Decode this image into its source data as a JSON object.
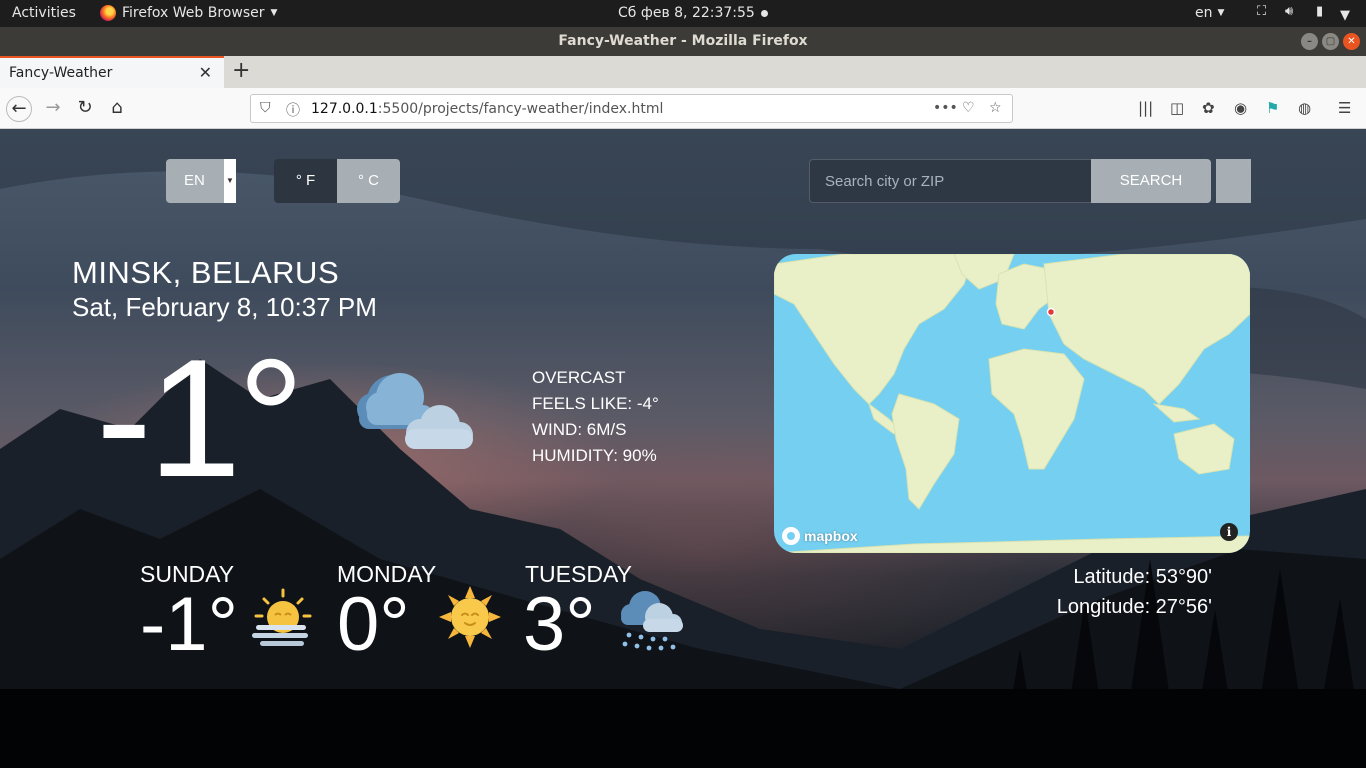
{
  "system_bar": {
    "activities": "Activities",
    "app_menu": "Firefox Web Browser",
    "clock": "Сб фев  8, 22:37:55",
    "keyboard_layout": "en"
  },
  "window": {
    "title": "Fancy-Weather - Mozilla Firefox"
  },
  "browser": {
    "tab_title": "Fancy-Weather",
    "url_host": "127.0.0.1",
    "url_rest": ":5500/projects/fancy-weather/index.html"
  },
  "controls": {
    "language": "EN",
    "unit_f": "° F",
    "unit_c": "° C",
    "search_placeholder": "Search city or ZIP",
    "search_button": "SEARCH"
  },
  "current": {
    "location": "MINSK, BELARUS",
    "datetime": "Sat, February 8, 10:37 PM",
    "temperature": "-1°",
    "icon": "cloudy-icon",
    "summary": "OVERCAST",
    "feels_like": "FEELS LIKE: -4°",
    "wind": "WIND: 6M/S",
    "humidity": "HUMIDITY: 90%"
  },
  "forecast": [
    {
      "day": "SUNDAY",
      "temp": "-1°",
      "icon": "fog-sun-icon"
    },
    {
      "day": "MONDAY",
      "temp": "0°",
      "icon": "sun-icon"
    },
    {
      "day": "TUESDAY",
      "temp": "3°",
      "icon": "rain-cloud-icon"
    }
  ],
  "map": {
    "attribution": "mapbox",
    "info": "i",
    "latitude": "Latitude: 53°90'",
    "longitude": "Longitude: 27°56'"
  },
  "colors": {
    "accent_button": "#a7afb4",
    "active_unit": "#2d3640",
    "map_water": "#75cff0",
    "map_land": "#e9f0c8",
    "ubuntu_orange": "#e95420"
  }
}
